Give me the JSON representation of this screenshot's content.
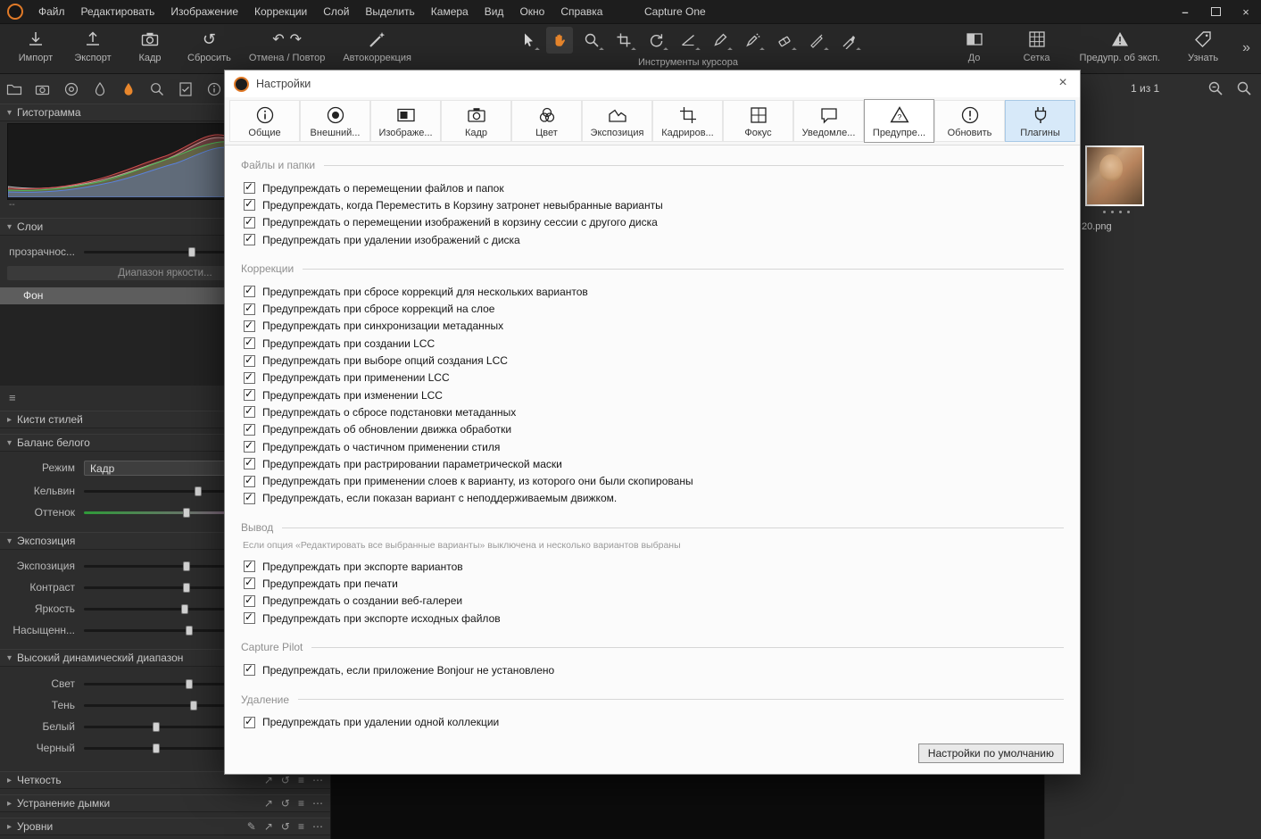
{
  "window": {
    "title": "Capture One",
    "controls": {
      "minimize": "–",
      "close": "×"
    }
  },
  "menu": {
    "items": [
      {
        "id": "file",
        "label": "Файл"
      },
      {
        "id": "edit",
        "label": "Редактировать"
      },
      {
        "id": "image",
        "label": "Изображение"
      },
      {
        "id": "adjustments",
        "label": "Коррекции"
      },
      {
        "id": "layer",
        "label": "Слой"
      },
      {
        "id": "select",
        "label": "Выделить"
      },
      {
        "id": "camera",
        "label": "Камера"
      },
      {
        "id": "view",
        "label": "Вид"
      },
      {
        "id": "window",
        "label": "Окно"
      },
      {
        "id": "help",
        "label": "Справка"
      }
    ]
  },
  "toolbar": {
    "buttons": [
      {
        "id": "import",
        "label": "Импорт"
      },
      {
        "id": "export",
        "label": "Экспорт"
      },
      {
        "id": "capture",
        "label": "Кадр"
      },
      {
        "id": "reset",
        "label": "Сбросить"
      },
      {
        "id": "undo_redo",
        "label": "Отмена / Повтор"
      },
      {
        "id": "autocorrect",
        "label": "Автокоррекция"
      }
    ],
    "cursor_tools_label": "Инструменты курсора",
    "cursor_tools": [
      {
        "id": "pointer",
        "menu": true
      },
      {
        "id": "pan",
        "selected": true
      },
      {
        "id": "loupe",
        "menu": true
      },
      {
        "id": "crop",
        "menu": true
      },
      {
        "id": "rotate",
        "menu": true
      },
      {
        "id": "straighten",
        "menu": true
      },
      {
        "id": "pen",
        "menu": true
      },
      {
        "id": "dotpen",
        "menu": true
      },
      {
        "id": "eraser",
        "menu": true
      },
      {
        "id": "finepen",
        "menu": true
      },
      {
        "id": "marker",
        "menu": true
      }
    ],
    "right_buttons": [
      {
        "id": "before",
        "label": "До"
      },
      {
        "id": "grid",
        "label": "Сетка"
      },
      {
        "id": "exposure_warning",
        "label": "Предупр. об эксп."
      },
      {
        "id": "learn",
        "label": "Узнать"
      }
    ],
    "overflow": "»"
  },
  "left_panel": {
    "tool_tabs": [
      {
        "id": "library"
      },
      {
        "id": "capture"
      },
      {
        "id": "lens"
      },
      {
        "id": "ink"
      },
      {
        "id": "adjustments",
        "selected": true
      },
      {
        "id": "zoom"
      },
      {
        "id": "checklist"
      },
      {
        "id": "info"
      }
    ],
    "histogram": {
      "title": "Гистограмма",
      "footer": "--"
    },
    "layers": {
      "title": "Слои",
      "opacity_label": "прозрачнос...",
      "opacity_pos": 0.46,
      "luma_range_button": "Диапазон яркости...",
      "layers_list": [
        {
          "name": "Фон",
          "selected": true
        }
      ]
    },
    "style_brushes": {
      "title": "Кисти стилей"
    },
    "white_balance": {
      "title": "Баланс белого",
      "mode_label": "Режим",
      "mode_value": "Кадр",
      "sliders": [
        {
          "label": "Кельвин",
          "pos": 0.49
        },
        {
          "label": "Оттенок",
          "pos": 0.44,
          "gradient": true
        }
      ]
    },
    "exposure": {
      "title": "Экспозиция",
      "sliders": [
        {
          "label": "Экспозиция",
          "pos": 0.44
        },
        {
          "label": "Контраст",
          "pos": 0.44
        },
        {
          "label": "Яркость",
          "pos": 0.43
        },
        {
          "label": "Насыщенн...",
          "pos": 0.45
        }
      ]
    },
    "hdr": {
      "title": "Высокий динамический диапазон",
      "sliders": [
        {
          "label": "Свет",
          "pos": 0.45
        },
        {
          "label": "Тень",
          "pos": 0.47
        },
        {
          "label": "Белый",
          "pos": 0.31
        },
        {
          "label": "Черный",
          "pos": 0.31
        }
      ]
    },
    "collapsed_panels": [
      {
        "id": "clarity",
        "title": "Четкость",
        "has_picker": false
      },
      {
        "id": "dehaze",
        "title": "Устранение дымки",
        "has_picker": false
      },
      {
        "id": "levels",
        "title": "Уровни",
        "has_picker": true
      }
    ]
  },
  "browser": {
    "counter": "1 из 1",
    "filename": "20.png"
  },
  "dialog": {
    "title": "Настройки",
    "close": "×",
    "tabs": [
      {
        "id": "general",
        "label": "Общие"
      },
      {
        "id": "appearance",
        "label": "Внешний..."
      },
      {
        "id": "image",
        "label": "Изображе..."
      },
      {
        "id": "capture",
        "label": "Кадр"
      },
      {
        "id": "color",
        "label": "Цвет"
      },
      {
        "id": "exposure",
        "label": "Экспозиция"
      },
      {
        "id": "crop",
        "label": "Кадриров..."
      },
      {
        "id": "focus",
        "label": "Фокус"
      },
      {
        "id": "notifications",
        "label": "Уведомле..."
      },
      {
        "id": "warnings",
        "label": "Предупре...",
        "selected": true
      },
      {
        "id": "update",
        "label": "Обновить"
      },
      {
        "id": "plugins",
        "label": "Плагины",
        "highlighted": true
      }
    ],
    "sections": [
      {
        "id": "files",
        "title": "Файлы и папки",
        "items": [
          {
            "label": "Предупреждать о перемещении файлов и папок",
            "checked": true
          },
          {
            "label": "Предупреждать, когда Переместить в Корзину затронет невыбранные варианты",
            "checked": true
          },
          {
            "label": "Предупреждать о перемещении изображений в корзину сессии с другого диска",
            "checked": true
          },
          {
            "label": "Предупреждать при удалении изображений с диска",
            "checked": true
          }
        ]
      },
      {
        "id": "adjustments",
        "title": "Коррекции",
        "items": [
          {
            "label": "Предупреждать при сбросе коррекций для нескольких вариантов",
            "checked": true
          },
          {
            "label": "Предупреждать при сбросе коррекций на слое",
            "checked": true
          },
          {
            "label": "Предупреждать при синхронизации метаданных",
            "checked": true
          },
          {
            "label": "Предупреждать при создании LCC",
            "checked": true
          },
          {
            "label": "Предупреждать при выборе опций создания LCC",
            "checked": true
          },
          {
            "label": "Предупреждать при применении LCC",
            "checked": true
          },
          {
            "label": "Предупреждать при изменении LCC",
            "checked": true
          },
          {
            "label": "Предупреждать о сбросе подстановки метаданных",
            "checked": true
          },
          {
            "label": "Предупреждать об обновлении движка обработки",
            "checked": true
          },
          {
            "label": "Предупреждать о частичном применении стиля",
            "checked": true
          },
          {
            "label": "Предупреждать при растрировании параметрической маски",
            "checked": true
          },
          {
            "label": "Предупреждать при применении слоев к варианту, из которого они были скопированы",
            "checked": true
          },
          {
            "label": "Предупреждать, если показан вариант с неподдерживаемым движком.",
            "checked": true
          }
        ]
      },
      {
        "id": "output",
        "title": "Вывод",
        "note": "Если опция «Редактировать все выбранные варианты» выключена и несколько вариантов выбраны",
        "items": [
          {
            "label": "Предупреждать при экспорте вариантов",
            "checked": true
          },
          {
            "label": "Предупреждать при печати",
            "checked": true
          },
          {
            "label": "Предупреждать о создании веб-галереи",
            "checked": true
          },
          {
            "label": "Предупреждать при экспорте исходных файлов",
            "checked": true
          }
        ]
      },
      {
        "id": "capture_pilot",
        "title": "Capture Pilot",
        "items": [
          {
            "label": "Предупреждать, если приложение Bonjour не установлено",
            "checked": true
          }
        ]
      },
      {
        "id": "deletion",
        "title": "Удаление",
        "items": [
          {
            "label": "Предупреждать при удалении одной коллекции",
            "checked": true
          }
        ]
      }
    ],
    "default_button": "Настройки по умолчанию"
  }
}
